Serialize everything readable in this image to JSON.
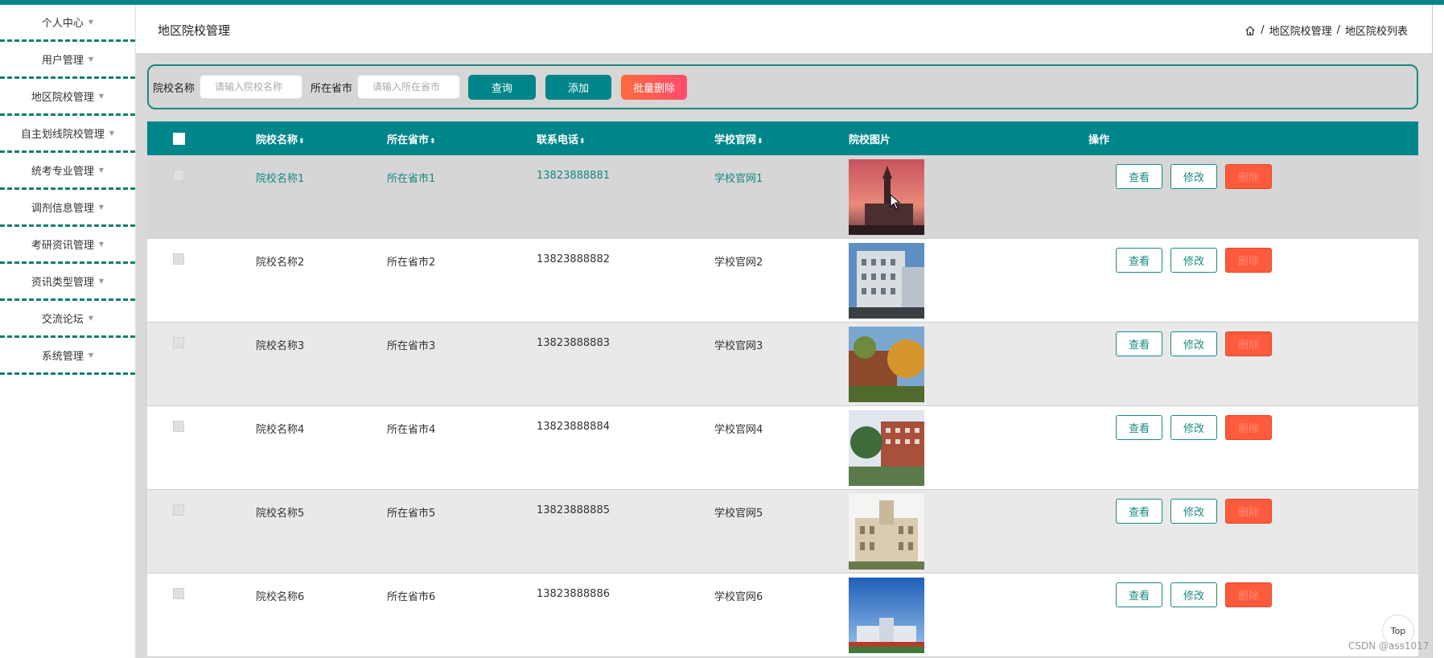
{
  "sidebar": {
    "items": [
      {
        "label": "个人中心"
      },
      {
        "label": "用户管理"
      },
      {
        "label": "地区院校管理"
      },
      {
        "label": "自主划线院校管理"
      },
      {
        "label": "统考专业管理"
      },
      {
        "label": "调剂信息管理"
      },
      {
        "label": "考研资讯管理"
      },
      {
        "label": "资讯类型管理"
      },
      {
        "label": "交流论坛"
      },
      {
        "label": "系统管理"
      }
    ]
  },
  "header": {
    "title": "地区院校管理",
    "breadcrumb": [
      "地区院校管理",
      "地区院校列表"
    ],
    "separator": "/"
  },
  "search": {
    "name_label": "院校名称",
    "name_placeholder": "请输入院校名称",
    "province_label": "所在省市",
    "province_placeholder": "请输入所在省市",
    "query_label": "查询",
    "add_label": "添加",
    "batch_delete_label": "批量删除"
  },
  "table": {
    "headers": {
      "name": "院校名称",
      "province": "所在省市",
      "phone": "联系电话",
      "website": "学校官网",
      "image": "院校图片",
      "ops": "操作"
    },
    "sort_glyph": "⬍",
    "op_labels": {
      "view": "查看",
      "edit": "修改",
      "delete": "删除"
    },
    "rows": [
      {
        "name": "院校名称1",
        "province": "所在省市1",
        "phone": "13823888881",
        "website": "学校官网1"
      },
      {
        "name": "院校名称2",
        "province": "所在省市2",
        "phone": "13823888882",
        "website": "学校官网2"
      },
      {
        "name": "院校名称3",
        "province": "所在省市3",
        "phone": "13823888883",
        "website": "学校官网3"
      },
      {
        "name": "院校名称4",
        "province": "所在省市4",
        "phone": "13823888884",
        "website": "学校官网4"
      },
      {
        "name": "院校名称5",
        "province": "所在省市5",
        "phone": "13823888885",
        "website": "学校官网5"
      },
      {
        "name": "院校名称6",
        "province": "所在省市6",
        "phone": "13823888886",
        "website": "学校官网6"
      }
    ]
  },
  "top_button": {
    "label": "Top"
  },
  "watermark": "CSDN @ass1017",
  "colors": {
    "primary": "#00868a",
    "danger": "#ff5a3c",
    "sidebar_divider": "#0e7f6e"
  }
}
